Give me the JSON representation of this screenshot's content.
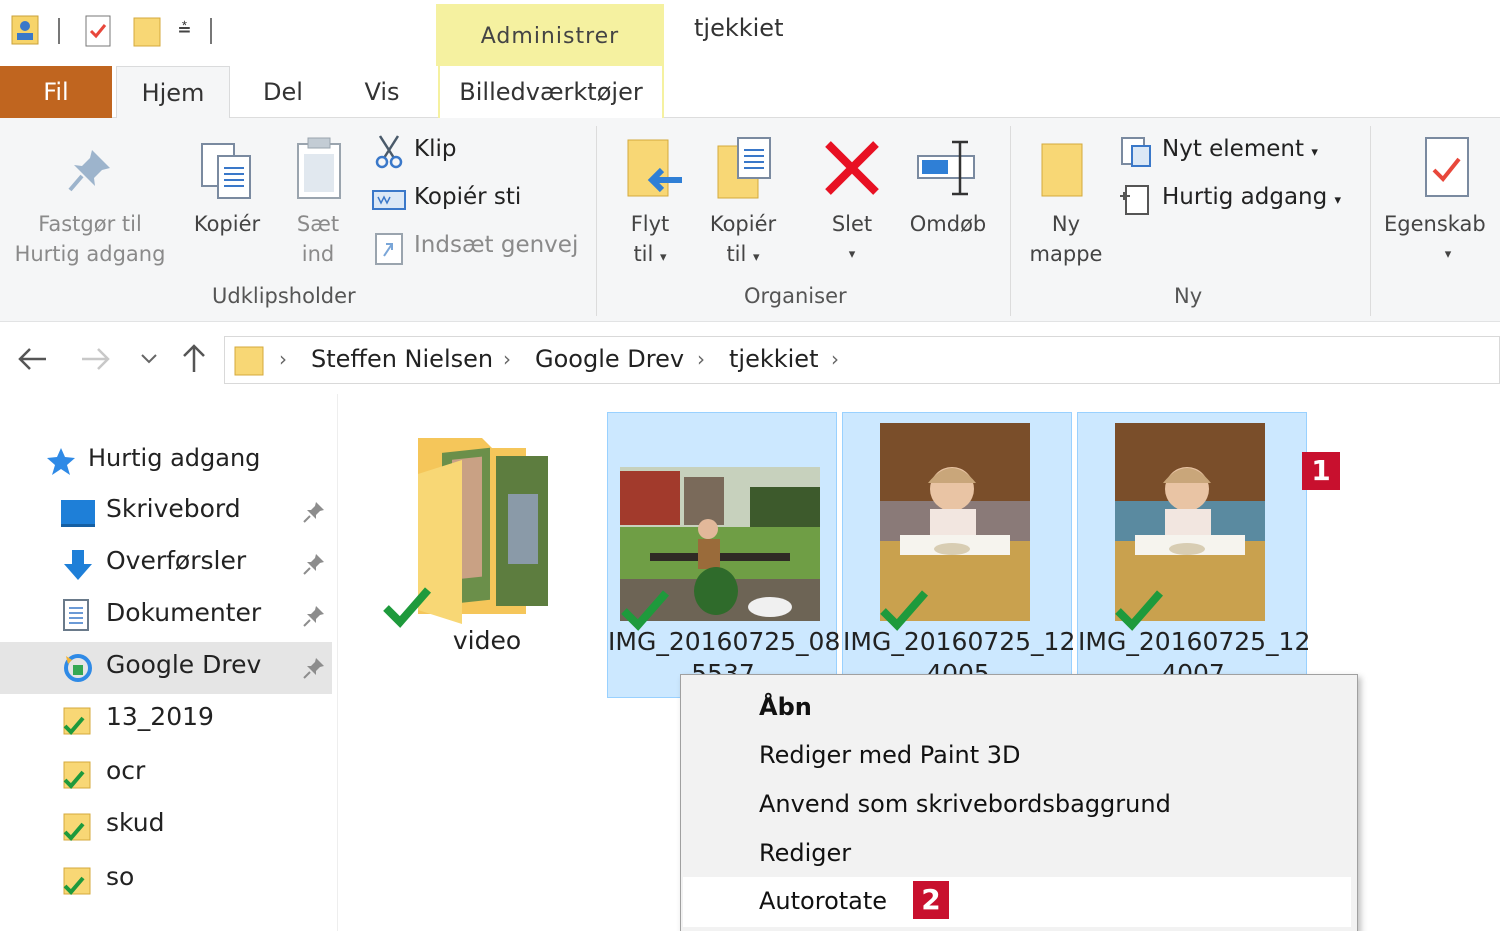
{
  "window": {
    "title": "tjekkiet",
    "context_tab_group": "Administrer"
  },
  "tabs": {
    "file": "Fil",
    "home": "Hjem",
    "share": "Del",
    "view": "Vis",
    "picture_tools": "Billedværktøjer"
  },
  "ribbon": {
    "clipboard": {
      "pin_quick_access": [
        "Fastgør til",
        "Hurtig adgang"
      ],
      "copy": "Kopiér",
      "paste": [
        "Sæt",
        "ind"
      ],
      "cut": "Klip",
      "copy_path": "Kopiér sti",
      "paste_shortcut": "Indsæt genvej",
      "group_label": "Udklipsholder"
    },
    "organize": {
      "move_to": [
        "Flyt",
        "til"
      ],
      "copy_to": [
        "Kopiér",
        "til"
      ],
      "delete": "Slet",
      "rename": "Omdøb",
      "group_label": "Organiser"
    },
    "new": {
      "new_folder": [
        "Ny",
        "mappe"
      ],
      "new_item": "Nyt element",
      "easy_access": "Hurtig adgang",
      "group_label": "Ny"
    },
    "open": {
      "properties": "Egenskab"
    }
  },
  "address": {
    "crumbs": [
      "Steffen Nielsen",
      "Google Drev",
      "tjekkiet"
    ]
  },
  "nav_pane": {
    "quick_access": "Hurtig adgang",
    "items": [
      "Skrivebord",
      "Overførsler",
      "Dokumenter",
      "Google Drev",
      "13_2019",
      "ocr",
      "skud",
      "so"
    ]
  },
  "files": [
    {
      "name": "video",
      "type": "folder"
    },
    {
      "name": "IMG_20160725_08",
      "name_cont": "5537",
      "type": "image"
    },
    {
      "name": "IMG_20160725_12",
      "name_cont": "4005",
      "type": "image"
    },
    {
      "name": "IMG_20160725_12",
      "name_cont": "4007",
      "type": "image"
    }
  ],
  "context_menu": {
    "items": [
      "Åbn",
      "Rediger med Paint 3D",
      "Anvend som skrivebordsbaggrund",
      "Rediger",
      "Autorotate"
    ]
  },
  "callouts": {
    "first": "1",
    "second": "2"
  },
  "colors": {
    "file_tab": "#c0651f",
    "context_tab": "#f5f1a0",
    "selection": "#cce8ff",
    "callout": "#c8102e",
    "delete_x": "#e81123"
  }
}
